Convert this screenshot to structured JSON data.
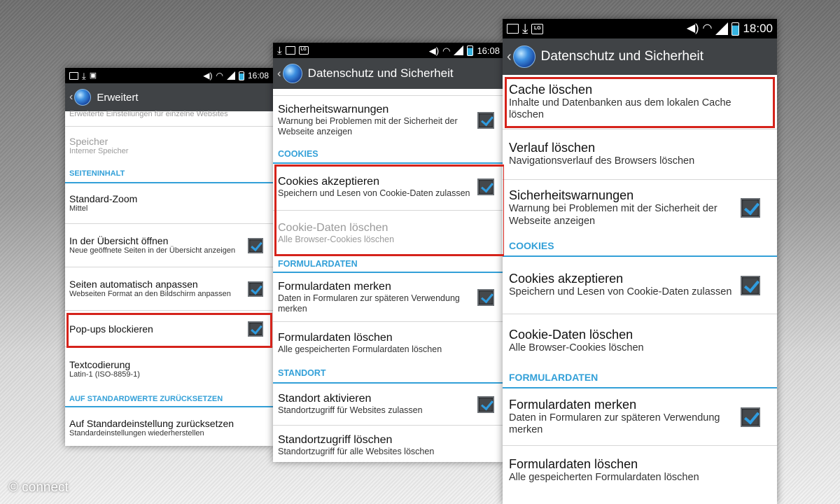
{
  "phone1": {
    "status": {
      "clock": "16:08"
    },
    "title": "Erweitert",
    "items": {
      "sites_desc": "Erweiterte Einstellungen für einzelne Websites",
      "storage": {
        "title": "Speicher",
        "summary": "Interner Speicher"
      },
      "page_content_header": "SEITENINHALT",
      "zoom": {
        "title": "Standard-Zoom",
        "summary": "Mittel"
      },
      "overview": {
        "title": "In der Übersicht öffnen",
        "summary": "Neue geöffnete Seiten in der Übersicht anzeigen",
        "checked": true
      },
      "autofit": {
        "title": "Seiten automatisch anpassen",
        "summary": "Webseiten Format an den Bildschirm anpassen",
        "checked": true
      },
      "popups": {
        "title": "Pop-ups blockieren",
        "checked": true
      },
      "encoding": {
        "title": "Textcodierung",
        "summary": "Latin-1 (ISO-8859-1)"
      },
      "reset_header": "AUF STANDARDWERTE ZURÜCKSETZEN",
      "reset": {
        "title": "Auf Standardeinstellung zurücksetzen",
        "summary": "Standardeinstellungen wiederherstellen"
      }
    }
  },
  "phone2": {
    "status": {
      "clock": "16:08"
    },
    "title": "Datenschutz und Sicherheit",
    "items": {
      "security": {
        "title": "Sicherheitswarnungen",
        "summary": "Warnung bei Problemen mit der Sicherheit der Webseite anzeigen",
        "checked": true
      },
      "cookies_header": "COOKIES",
      "accept_cookies": {
        "title": "Cookies akzeptieren",
        "summary": "Speichern und Lesen von Cookie-Daten zulassen",
        "checked": true
      },
      "clear_cookies": {
        "title": "Cookie-Daten löschen",
        "summary": "Alle Browser-Cookies löschen"
      },
      "formdata_header": "FORMULARDATEN",
      "remember_form": {
        "title": "Formulardaten merken",
        "summary": "Daten in Formularen zur späteren Verwendung merken",
        "checked": true
      },
      "clear_form": {
        "title": "Formulardaten löschen",
        "summary": "Alle gespeicherten Formulardaten löschen"
      },
      "location_header": "STANDORT",
      "enable_location": {
        "title": "Standort aktivieren",
        "summary": "Standortzugriff für Websites zulassen",
        "checked": true
      },
      "clear_location": {
        "title": "Standortzugriff löschen",
        "summary": "Standortzugriff für alle Websites löschen"
      }
    }
  },
  "phone3": {
    "status": {
      "clock": "18:00"
    },
    "title": "Datenschutz und Sicherheit",
    "items": {
      "clear_cache": {
        "title": "Cache löschen",
        "summary": "Inhalte und Datenbanken aus dem lokalen Cache löschen"
      },
      "clear_history": {
        "title": "Verlauf löschen",
        "summary": "Navigationsverlauf des Browsers löschen"
      },
      "security": {
        "title": "Sicherheitswarnungen",
        "summary": "Warnung bei Problemen mit der Sicherheit der Webseite anzeigen",
        "checked": true
      },
      "cookies_header": "COOKIES",
      "accept_cookies": {
        "title": "Cookies akzeptieren",
        "summary": "Speichern und Lesen von Cookie-Daten zulassen",
        "checked": true
      },
      "clear_cookies": {
        "title": "Cookie-Daten löschen",
        "summary": "Alle Browser-Cookies löschen"
      },
      "formdata_header": "FORMULARDATEN",
      "remember_form": {
        "title": "Formulardaten merken",
        "summary": "Daten in Formularen zur späteren Verwendung merken",
        "checked": true
      },
      "clear_form": {
        "title": "Formulardaten löschen",
        "summary": "Alle gespeicherten Formulardaten löschen"
      }
    }
  },
  "watermark": "© connect",
  "colors": {
    "accent": "#33a0d8",
    "highlight": "#d5231b",
    "actionbar": "#404346"
  },
  "icons": [
    "back-arrow-icon",
    "browser-globe-icon",
    "checkbox-checked-icon",
    "image-icon",
    "download-icon",
    "lg-icon",
    "volume-icon",
    "wifi-icon",
    "signal-icon",
    "battery-icon"
  ]
}
